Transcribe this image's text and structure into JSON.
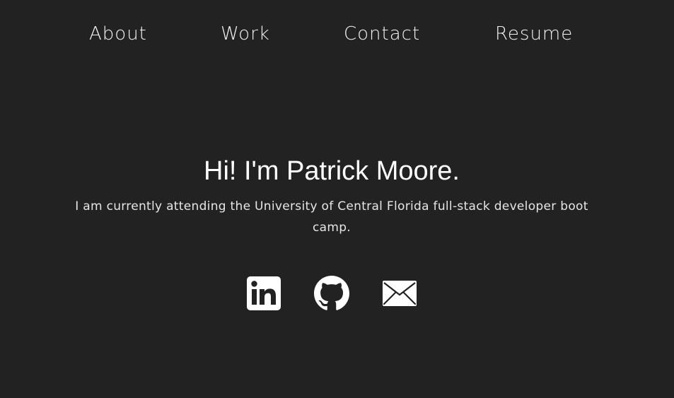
{
  "nav": {
    "items": [
      {
        "label": "About"
      },
      {
        "label": "Work"
      },
      {
        "label": "Contact"
      },
      {
        "label": "Resume"
      }
    ]
  },
  "hero": {
    "title": "Hi! I'm Patrick Moore.",
    "description": "I am currently attending the University of Central Florida full-stack developer boot camp."
  },
  "socials": [
    {
      "icon": "linkedin-icon"
    },
    {
      "icon": "github-icon"
    },
    {
      "icon": "email-icon"
    }
  ],
  "colors": {
    "background": "#222222",
    "text": "#ffffff"
  }
}
